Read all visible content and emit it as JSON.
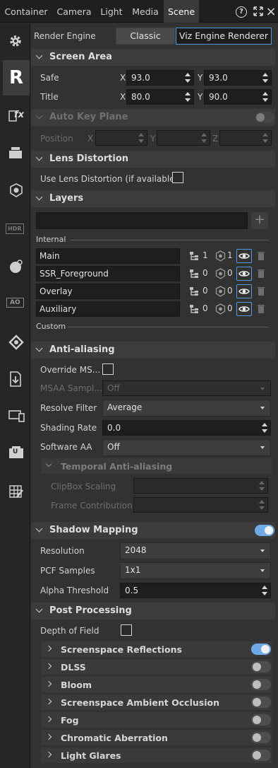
{
  "tabs": [
    {
      "label": "Container"
    },
    {
      "label": "Camera"
    },
    {
      "label": "Light"
    },
    {
      "label": "Media"
    },
    {
      "label": "Scene"
    }
  ],
  "top_icons": {
    "help": "?",
    "expand": "expand-icon",
    "close": "×"
  },
  "render_engine": {
    "label": "Render Engine",
    "classic": "Classic",
    "viz": "Viz Engine Renderer"
  },
  "screen_area": {
    "title": "Screen Area",
    "safe_label": "Safe",
    "title_label": "Title",
    "x": "X",
    "y": "Y",
    "safe_x": "93.0",
    "safe_y": "93.0",
    "title_x": "80.0",
    "title_y": "90.0"
  },
  "auto_key": {
    "title": "Auto Key Plane",
    "position_label": "Position",
    "x": "X",
    "y": "Y",
    "z": "Z"
  },
  "lens": {
    "title": "Lens Distortion",
    "use_label": "Use Lens Distortion (if available)"
  },
  "layers": {
    "title": "Layers",
    "add": "+",
    "internal": "Internal",
    "custom": "Custom",
    "items": [
      {
        "name": "Main",
        "count1": "1",
        "count2": "1"
      },
      {
        "name": "SSR_Foreground",
        "count1": "0",
        "count2": "0"
      },
      {
        "name": "Overlay",
        "count1": "0",
        "count2": "0"
      },
      {
        "name": "Auxiliary",
        "count1": "0",
        "count2": "0"
      }
    ]
  },
  "aa": {
    "title": "Anti-aliasing",
    "override": "Override MS...",
    "msaa": "MSAA Sampl...",
    "msaa_value": "Off",
    "resolve": "Resolve Filter",
    "resolve_value": "Average",
    "shading": "Shading Rate",
    "shading_value": "0.0",
    "software": "Software AA",
    "software_value": "Off",
    "temporal": "Temporal Anti-aliasing",
    "clipbox": "ClipBox Scaling",
    "frame": "Frame Contribution"
  },
  "shadow": {
    "title": "Shadow Mapping",
    "resolution": "Resolution",
    "resolution_value": "2048",
    "pcf": "PCF Samples",
    "pcf_value": "1x1",
    "alpha": "Alpha Threshold",
    "alpha_value": "0.5"
  },
  "post": {
    "title": "Post Processing",
    "dof": "Depth of Field",
    "items": [
      {
        "label": "Screenspace Reflections",
        "on": true
      },
      {
        "label": "DLSS",
        "on": false
      },
      {
        "label": "Bloom",
        "on": false
      },
      {
        "label": "Screenspace Ambient Occlusion",
        "on": false
      },
      {
        "label": "Fog",
        "on": false
      },
      {
        "label": "Chromatic Aberration",
        "on": false
      },
      {
        "label": "Light Glares",
        "on": false
      }
    ]
  },
  "sidebar": [
    "settings-icon",
    "render-icon",
    "fx-icon",
    "layers-icon",
    "material-icon",
    "hdr-icon",
    "globe-icon",
    "ao-icon",
    "sync-icon",
    "export-icon",
    "devices-icon",
    "unreal-icon",
    "edit-grid-icon"
  ],
  "sidebar_text": {
    "hdr": "HDR",
    "ao": "AO",
    "fx": "fx",
    "r": "R",
    "u": "U"
  },
  "colors": {
    "accent": "#4e9ce8",
    "toggle_on": "#6fa9e6"
  }
}
